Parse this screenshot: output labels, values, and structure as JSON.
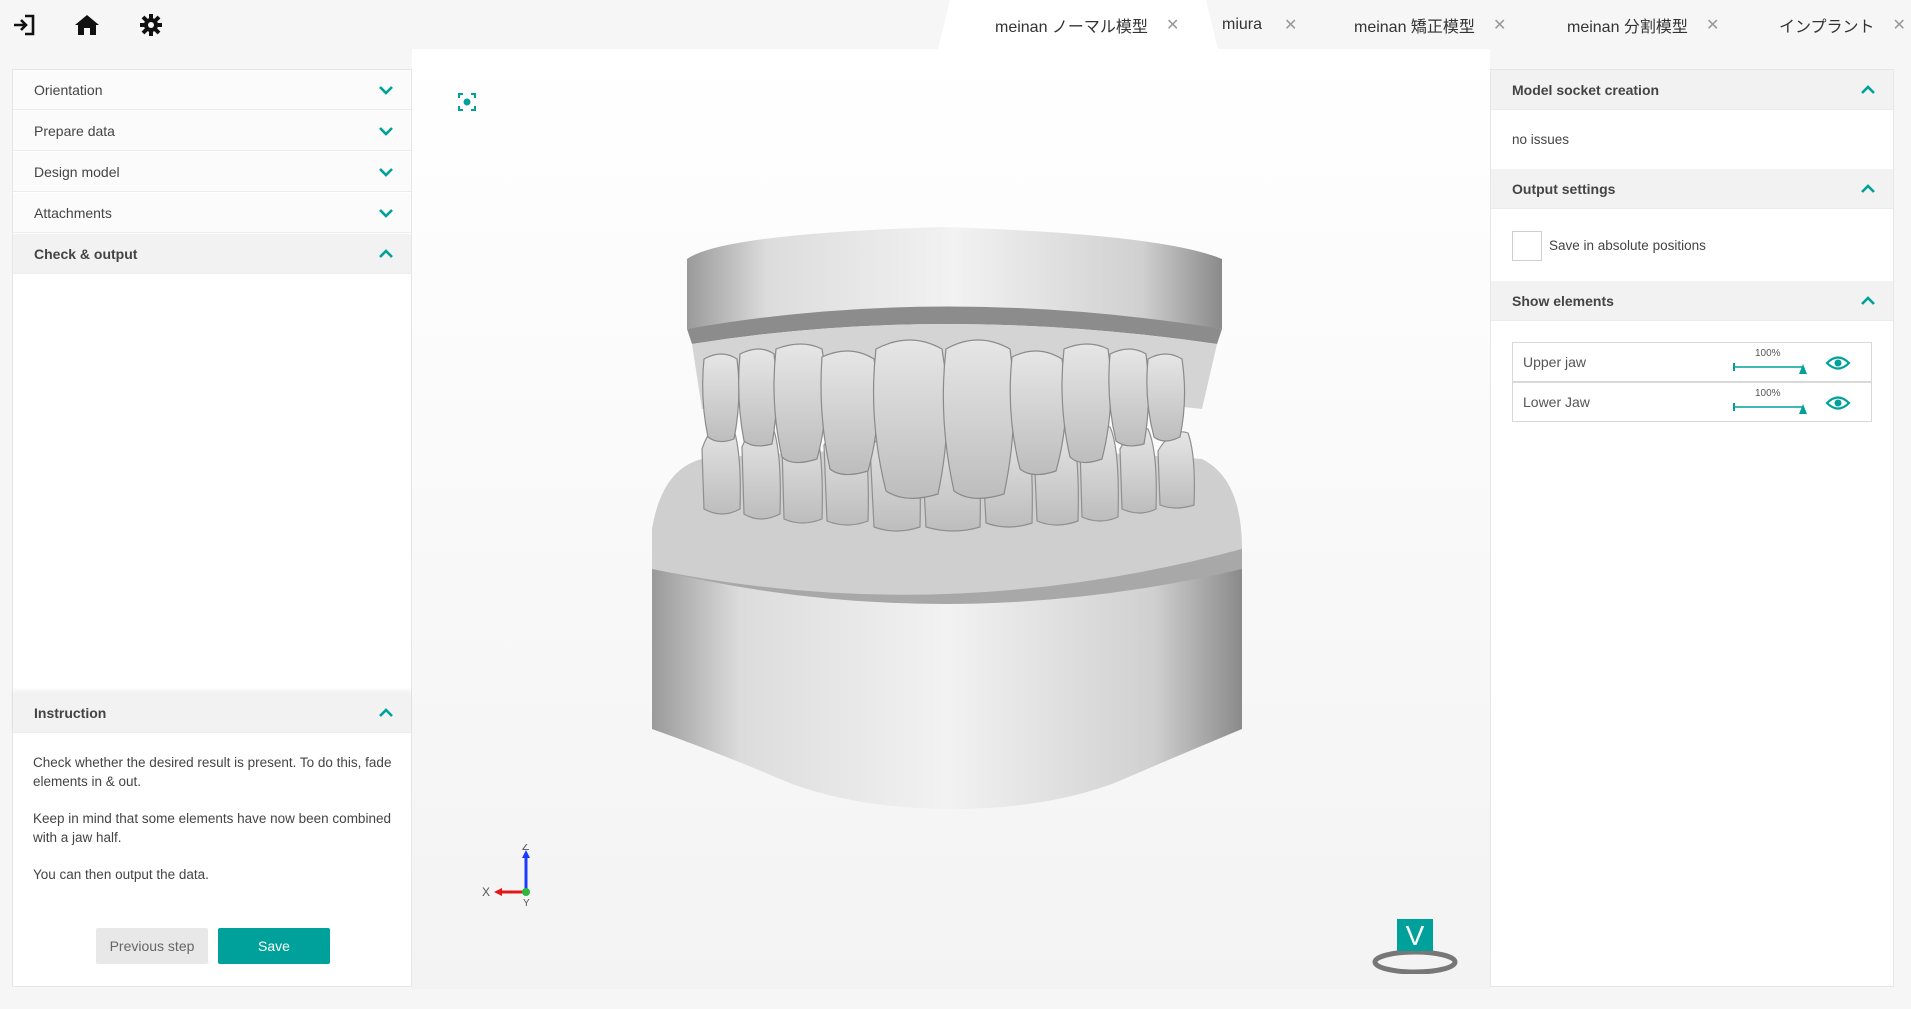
{
  "colors": {
    "accent": "#00a19a",
    "panel_bg": "#ffffff",
    "app_bg": "#f6f6f6"
  },
  "topbar": {
    "icons": [
      "sign-in-icon",
      "home-icon",
      "gear-icon"
    ],
    "tabs": [
      {
        "label": "meinan ノーマル模型",
        "active": true
      },
      {
        "label": "miura",
        "active": false
      },
      {
        "label": "meinan 矯正模型",
        "active": false
      },
      {
        "label": "meinan 分割模型",
        "active": false
      },
      {
        "label": "インプラント",
        "active": false
      }
    ]
  },
  "left_panel": {
    "steps": [
      {
        "label": "Orientation",
        "expanded": false
      },
      {
        "label": "Prepare data",
        "expanded": false
      },
      {
        "label": "Design model",
        "expanded": false
      },
      {
        "label": "Attachments",
        "expanded": false
      },
      {
        "label": "Check & output",
        "expanded": true
      }
    ],
    "instruction": {
      "title": "Instruction",
      "paragraphs": [
        "Check whether the desired result is present. To do this, fade elements in & out.",
        "Keep in mind that some elements have now been combined with a jaw half.",
        "You can then output the data."
      ]
    },
    "buttons": {
      "previous": "Previous step",
      "save": "Save"
    }
  },
  "viewport": {
    "axes": {
      "x": "X",
      "y": "Y",
      "z": "Z"
    },
    "logo_letter": "V"
  },
  "right_panel": {
    "socket": {
      "title": "Model socket creation",
      "status": "no issues"
    },
    "output": {
      "title": "Output settings",
      "checkbox_label": "Save in absolute positions",
      "checked": false
    },
    "elements": {
      "title": "Show elements",
      "items": [
        {
          "label": "Upper jaw",
          "opacity": "100%",
          "visible": true
        },
        {
          "label": "Lower Jaw",
          "opacity": "100%",
          "visible": true
        }
      ]
    }
  }
}
